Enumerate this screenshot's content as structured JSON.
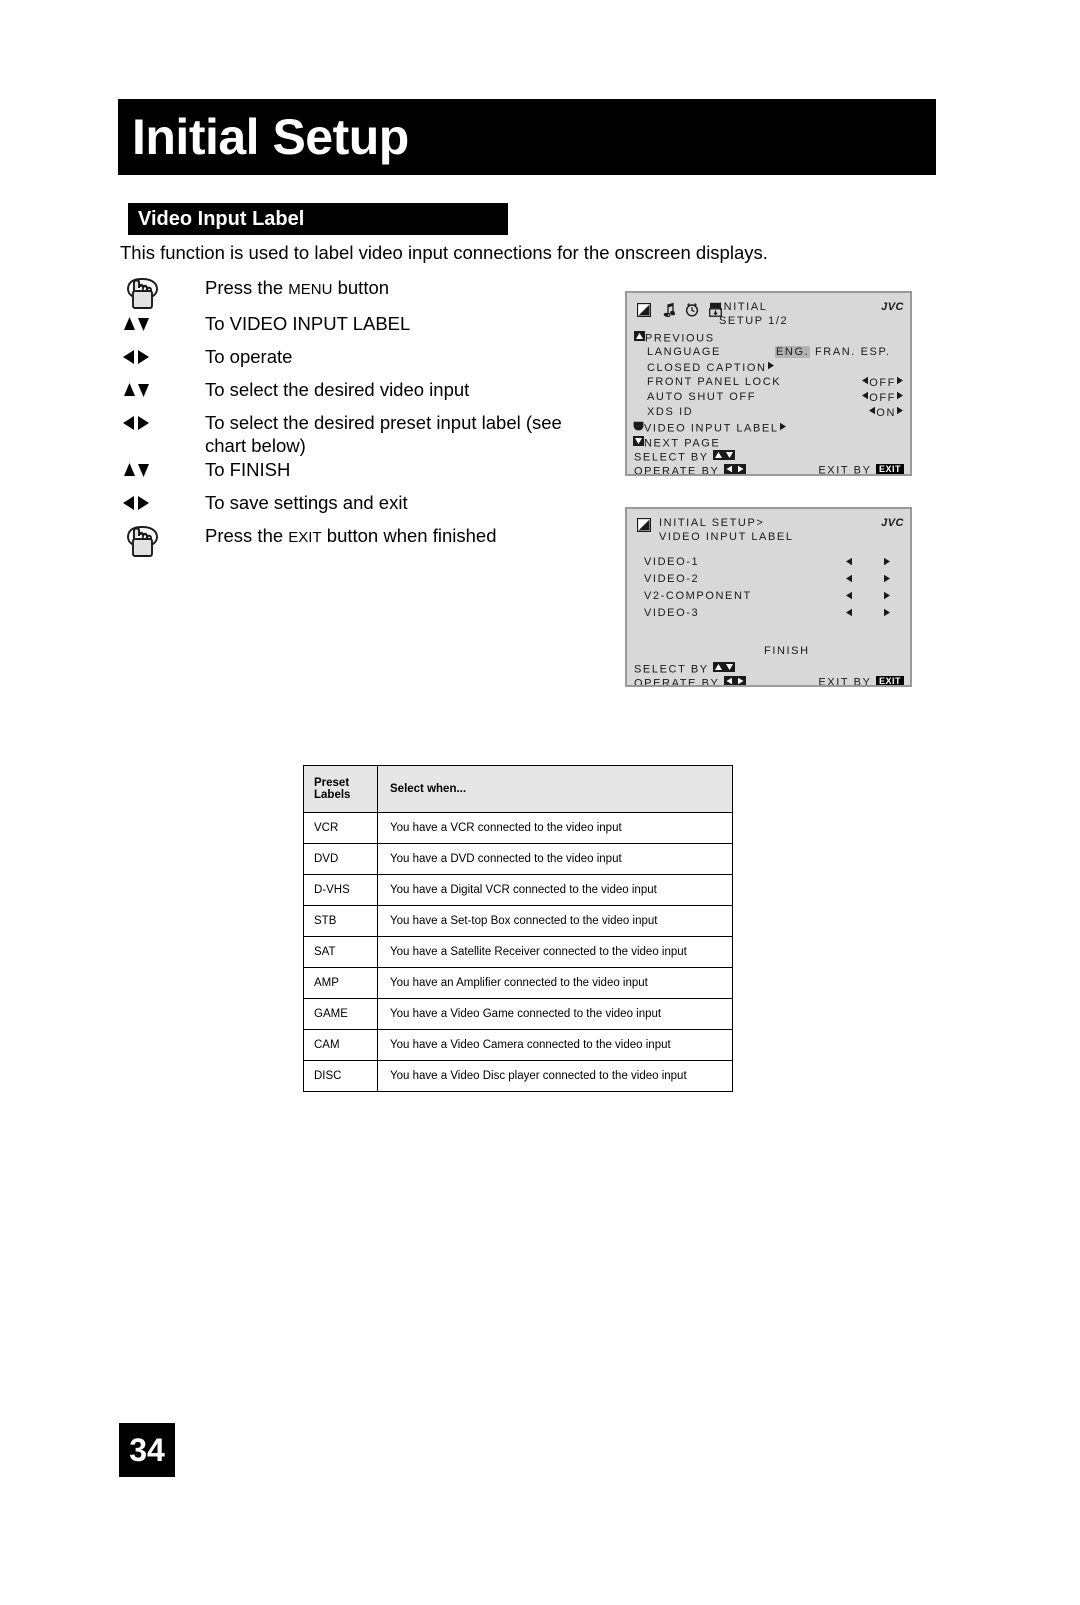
{
  "page": {
    "title": "Initial Setup",
    "section_title": "Video Input Label",
    "intro": "This function is used to label video input connections for the onscreen displays.",
    "page_number": "34"
  },
  "steps": [
    {
      "icon": "hand-press-button-icon",
      "text_prefix": "Press the ",
      "text_smallcap": "Menu",
      "text_suffix": " button"
    },
    {
      "icon": "up-down-arrows-icon",
      "text": "To VIDEO INPUT LABEL"
    },
    {
      "icon": "left-right-arrows-icon",
      "text": "To operate"
    },
    {
      "icon": "up-down-arrows-icon",
      "text": "To select the desired video input"
    },
    {
      "icon": "left-right-arrows-icon",
      "text": "To select the desired preset input label (see chart below)"
    },
    {
      "icon": "up-down-arrows-icon",
      "text": "To FINISH"
    },
    {
      "icon": "left-right-arrows-icon",
      "text": "To save settings and exit"
    },
    {
      "icon": "hand-press-button-icon",
      "text_prefix": "Press the ",
      "text_smallcap": "Exit",
      "text_suffix": " button when finished"
    }
  ],
  "osd1": {
    "brand": "JVC",
    "title_line1": "INITIAL",
    "title_line2": "SETUP 1/2",
    "previous": "PREVIOUS",
    "rows": [
      {
        "label": "LANGUAGE",
        "value_selected": "ENG.",
        "value_rest": "FRAN. ESP."
      },
      {
        "label": "CLOSED CAPTION",
        "arrow": "right"
      },
      {
        "label": "FRONT PANEL LOCK",
        "value": "OFF"
      },
      {
        "label": "AUTO SHUT OFF",
        "value": "OFF"
      },
      {
        "label": "XDS ID",
        "value": "ON"
      }
    ],
    "cursor_item": "VIDEO INPUT LABEL",
    "next_page": "NEXT PAGE",
    "footer_select": "SELECT   BY",
    "footer_operate": "OPERATE BY",
    "footer_exit": "EXIT BY",
    "exit_badge": "EXIT"
  },
  "osd2": {
    "brand": "JVC",
    "title_line1": "INITIAL SETUP>",
    "title_line2": "VIDEO INPUT LABEL",
    "inputs": [
      "VIDEO-1",
      "VIDEO-2",
      "V2-COMPONENT",
      "VIDEO-3"
    ],
    "finish": "FINISH",
    "footer_select": "SELECT   BY",
    "footer_operate": "OPERATE BY",
    "footer_exit": "EXIT BY",
    "exit_badge": "EXIT"
  },
  "table": {
    "headers": {
      "col1": "Preset\nLabels",
      "col1_line1": "Preset",
      "col1_line2": "Labels",
      "col2": "Select when..."
    },
    "rows": [
      {
        "label": "VCR",
        "desc": "You have a VCR connected to the video input"
      },
      {
        "label": "DVD",
        "desc": "You have a DVD connected to the video input"
      },
      {
        "label": "D-VHS",
        "desc": "You have a Digital VCR connected to the video input"
      },
      {
        "label": "STB",
        "desc": "You have a Set-top Box connected to the video input"
      },
      {
        "label": "SAT",
        "desc": "You have a Satellite Receiver connected to the video input"
      },
      {
        "label": "AMP",
        "desc": "You have an Amplifier connected to the video input"
      },
      {
        "label": "GAME",
        "desc": "You have a Video Game connected to the video input"
      },
      {
        "label": "CAM",
        "desc": "You have a Video Camera connected to the video input"
      },
      {
        "label": "DISC",
        "desc": "You have a Video Disc player connected to the video input"
      }
    ]
  },
  "colors": {
    "banner": "#000000",
    "osd_background": "#d8d8d8",
    "osd_border": "#9a9a9a",
    "osd_highlight": "#b3b3b3",
    "table_header": "#e6e6e6"
  }
}
